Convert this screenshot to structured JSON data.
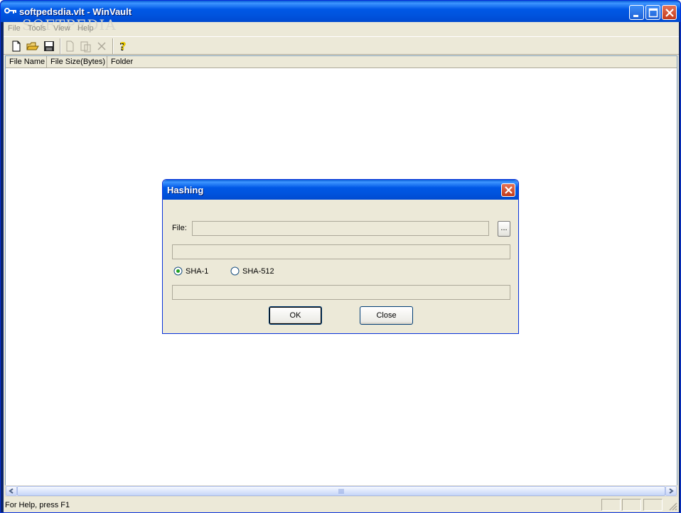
{
  "window": {
    "title": "softpedsdia.vlt - WinVault",
    "watermark": "SOFTPEDIA"
  },
  "menu": [
    {
      "label": "File"
    },
    {
      "label": "Tools"
    },
    {
      "label": "View"
    },
    {
      "label": "Help"
    }
  ],
  "toolbar": [
    {
      "icon": "new-file-icon"
    },
    {
      "icon": "open-folder-icon"
    },
    {
      "icon": "save-disk-icon"
    },
    {
      "icon": "copy-icon"
    },
    {
      "icon": "paste-icon"
    },
    {
      "icon": "delete-icon"
    },
    {
      "icon": "help-icon"
    }
  ],
  "list": {
    "columns": [
      "File Name",
      "File Size(Bytes)",
      "Folder"
    ]
  },
  "status": {
    "text": "For Help, press F1"
  },
  "dialog": {
    "title": "Hashing",
    "file_label": "File:",
    "file_value": "",
    "browse_label": "...",
    "progress_value": "",
    "radio_sha1": "SHA-1",
    "radio_sha512": "SHA-512",
    "selected_algorithm": "SHA-1",
    "hash_value": "",
    "ok_label": "OK",
    "close_label": "Close"
  }
}
